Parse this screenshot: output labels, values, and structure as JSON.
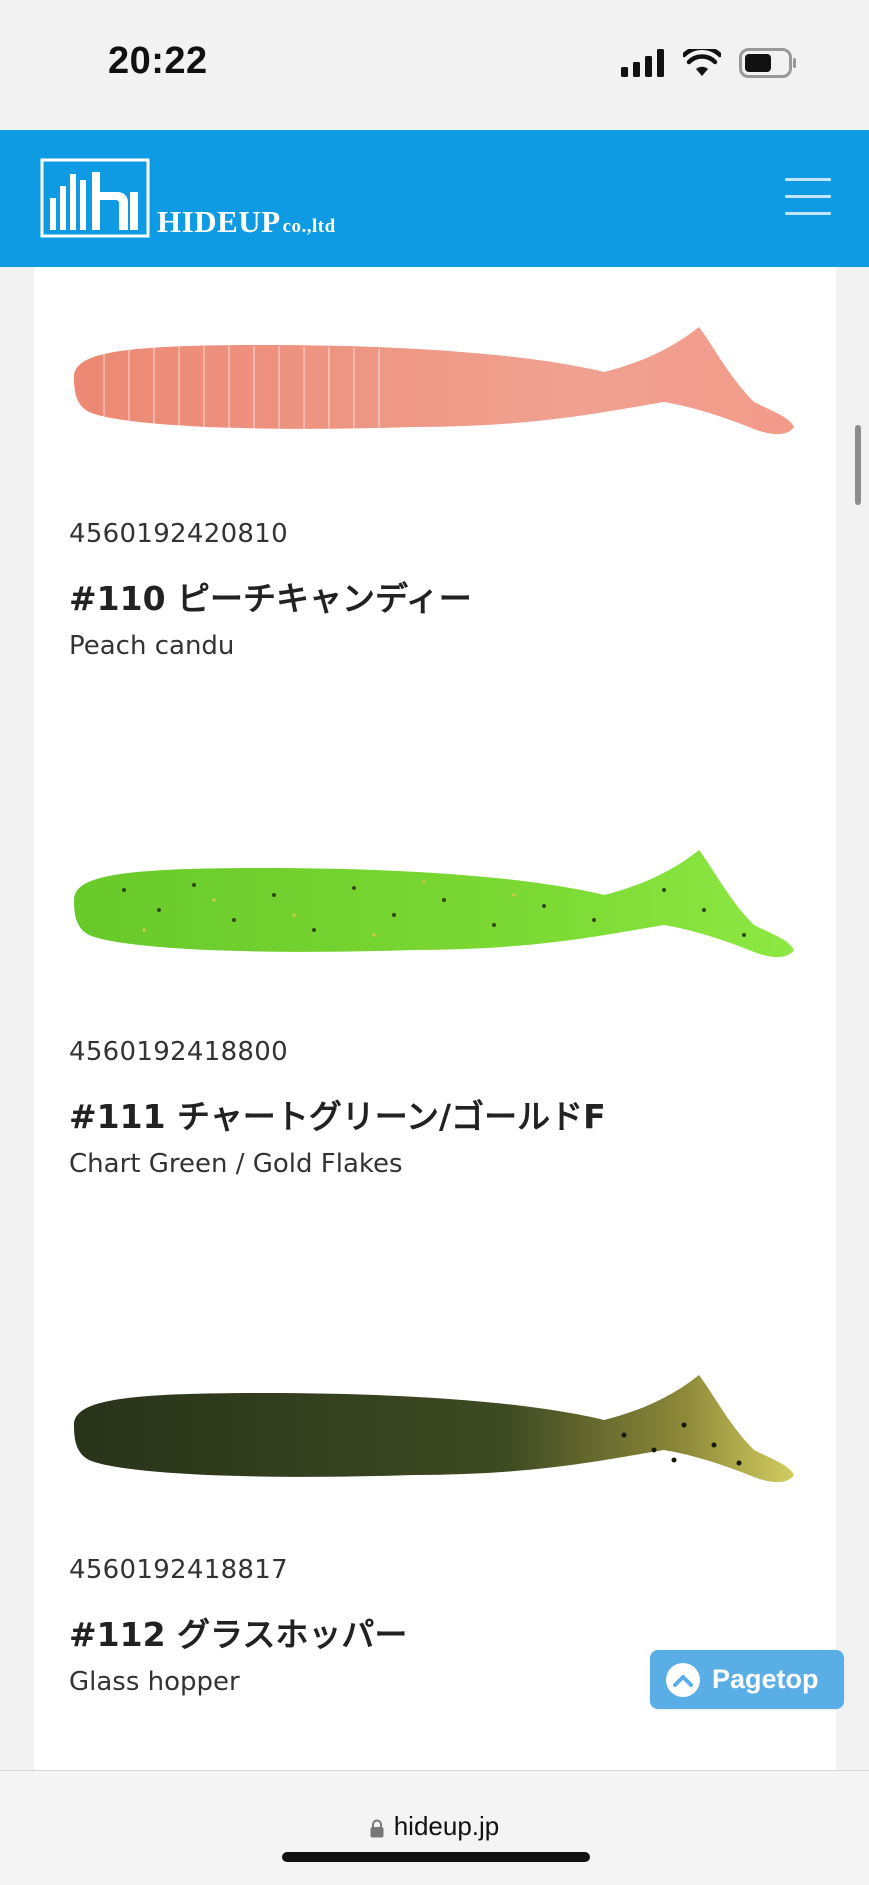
{
  "status_bar": {
    "time": "20:22"
  },
  "header": {
    "brand": "HIDEUP",
    "brand_suffix": "co.,ltd",
    "menu_icon": "hamburger-menu-icon",
    "background": "#0f9be3"
  },
  "products": [
    {
      "jan": "4560192420810",
      "name": "#110 ピーチキャンディー",
      "english": "Peach candu",
      "body_color": "#ef8f7a",
      "tail_color": "#f4a090"
    },
    {
      "jan": "4560192418800",
      "name": "#111 チャートグリーン/ゴールドF",
      "english": "Chart Green / Gold Flakes",
      "body_color": "#6fcf2c",
      "tail_color": "#86e040"
    },
    {
      "jan": "4560192418817",
      "name": "#112 グラスホッパー",
      "english": "Glass hopper",
      "body_color": "#2e3a1c",
      "tail_color": "#c7c052"
    }
  ],
  "pagetop": {
    "label": "Pagetop",
    "icon": "chevron-up-icon",
    "color": "#5aaee6"
  },
  "browser": {
    "url": "hideup.jp",
    "icon": "lock-icon"
  }
}
